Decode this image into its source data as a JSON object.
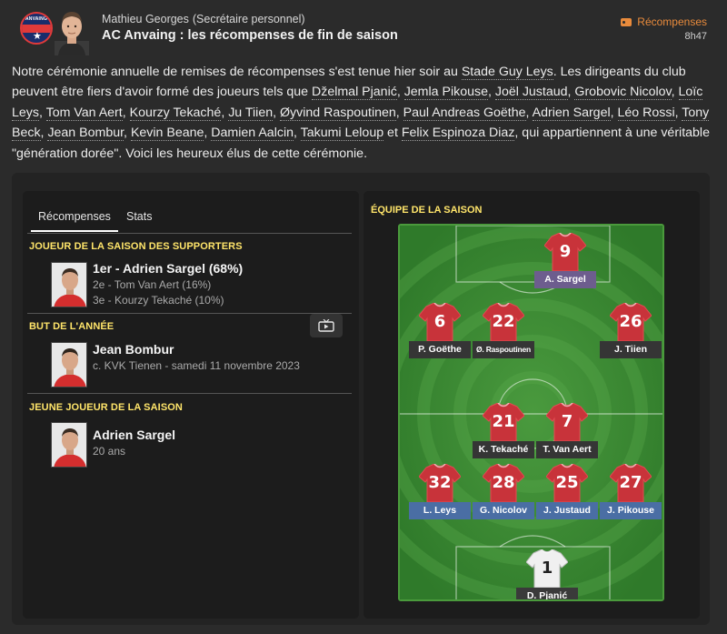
{
  "header": {
    "sender_name": "Mathieu Georges",
    "sender_role": "(Secrétaire personnel)",
    "title": "AC Anvaing : les récompenses de fin de saison",
    "category": "Récompenses",
    "time": "8h47",
    "badge_text": "ANVAING",
    "badge_icon": "star-icon"
  },
  "body": {
    "p1": "Notre cérémonie annuelle de remises de récompenses s'est tenue hier soir au ",
    "stadium": "Stade Guy Leys",
    "p2": ". Les dirigeants du club peuvent être fiers d'avoir formé des joueurs tels que ",
    "names": [
      "Dželmal Pjanić",
      "Jemla Pikouse",
      "Joël Justaud",
      "Grobovic Nicolov",
      "Loïc Leys",
      "Tom Van Aert",
      "Kourzy Tekaché",
      "Ju Tiien",
      "Øyvind Raspoutinen",
      "Paul Andreas Goëthe",
      "Adrien Sargel",
      "Léo Rossi",
      "Tony Beck",
      "Jean Bombur",
      "Kevin Beane",
      "Damien Aalcin",
      "Takumi Leloup",
      "Felix Espinoza Diaz"
    ],
    "p3": ", qui appartiennent à une véritable \"génération dorée\". Voici les heureux élus de cette cérémonie."
  },
  "tabs": [
    {
      "label": "Récompenses",
      "active": true
    },
    {
      "label": "Stats",
      "active": false
    }
  ],
  "awards": [
    {
      "title": "JOUEUR DE LA SAISON DES SUPPORTERS",
      "winner": "1er - Adrien Sargel (68%)",
      "others": [
        "2e - Tom Van Aert (16%)",
        "3e - Kourzy Tekaché (10%)"
      ]
    },
    {
      "title": "BUT DE L'ANNÉE",
      "winner": "Jean Bombur",
      "detail": "c. KVK Tienen - samedi 11 novembre 2023",
      "video_icon": "tv-icon"
    },
    {
      "title": "JEUNE JOUEUR DE LA SAISON",
      "winner": "Adrien Sargel",
      "detail": "20 ans"
    }
  ],
  "team": {
    "title": "ÉQUIPE DE LA SAISON",
    "players": [
      {
        "number": "9",
        "name": "A. Sargel",
        "role": "att"
      },
      {
        "number": "6",
        "name": "P. Goëthe",
        "role": "mid"
      },
      {
        "number": "22",
        "name": "Ø. Raspoutinen",
        "role": "mid"
      },
      {
        "number": "26",
        "name": "J. Tiien",
        "role": "mid"
      },
      {
        "number": "21",
        "name": "K. Tekaché",
        "role": "mid"
      },
      {
        "number": "7",
        "name": "T. Van Aert",
        "role": "mid"
      },
      {
        "number": "32",
        "name": "L. Leys",
        "role": "def"
      },
      {
        "number": "28",
        "name": "G. Nicolov",
        "role": "def"
      },
      {
        "number": "25",
        "name": "J. Justaud",
        "role": "def"
      },
      {
        "number": "27",
        "name": "J. Pikouse",
        "role": "def"
      },
      {
        "number": "1",
        "name": "D. Pjanić",
        "role": "gk"
      }
    ]
  },
  "colors": {
    "accent_yellow": "#ffe56a",
    "category_orange": "#e98b3c",
    "shirt_red": "#c8333a",
    "pitch_green": "#3f8d36"
  }
}
